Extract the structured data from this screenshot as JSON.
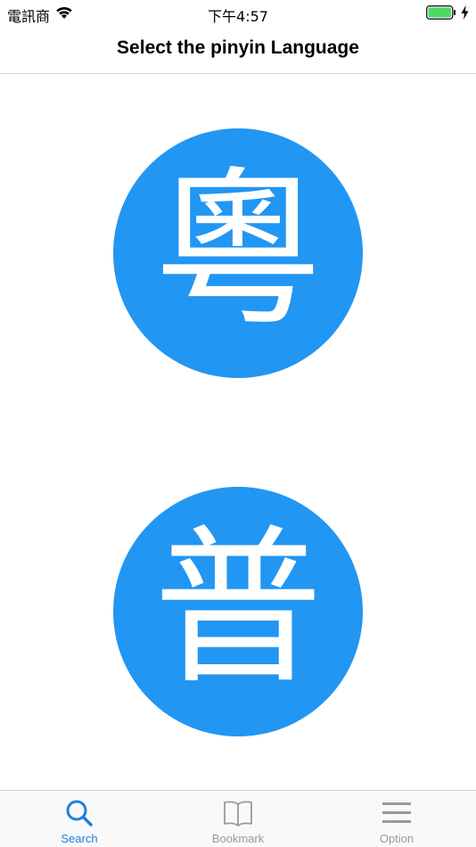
{
  "status_bar": {
    "carrier": "電訊商",
    "time": "下午4:57"
  },
  "nav": {
    "title": "Select the pinyin Language"
  },
  "languages": [
    {
      "char": "粵"
    },
    {
      "char": "普"
    }
  ],
  "tabs": [
    {
      "label": "Search",
      "icon": "search-icon",
      "active": true
    },
    {
      "label": "Bookmark",
      "icon": "book-icon",
      "active": false
    },
    {
      "label": "Option",
      "icon": "menu-icon",
      "active": false
    }
  ],
  "colors": {
    "accent": "#2196f3",
    "tab_active": "#1d7fe0",
    "tab_inactive": "#9a9a9a",
    "battery": "#4cd964"
  }
}
